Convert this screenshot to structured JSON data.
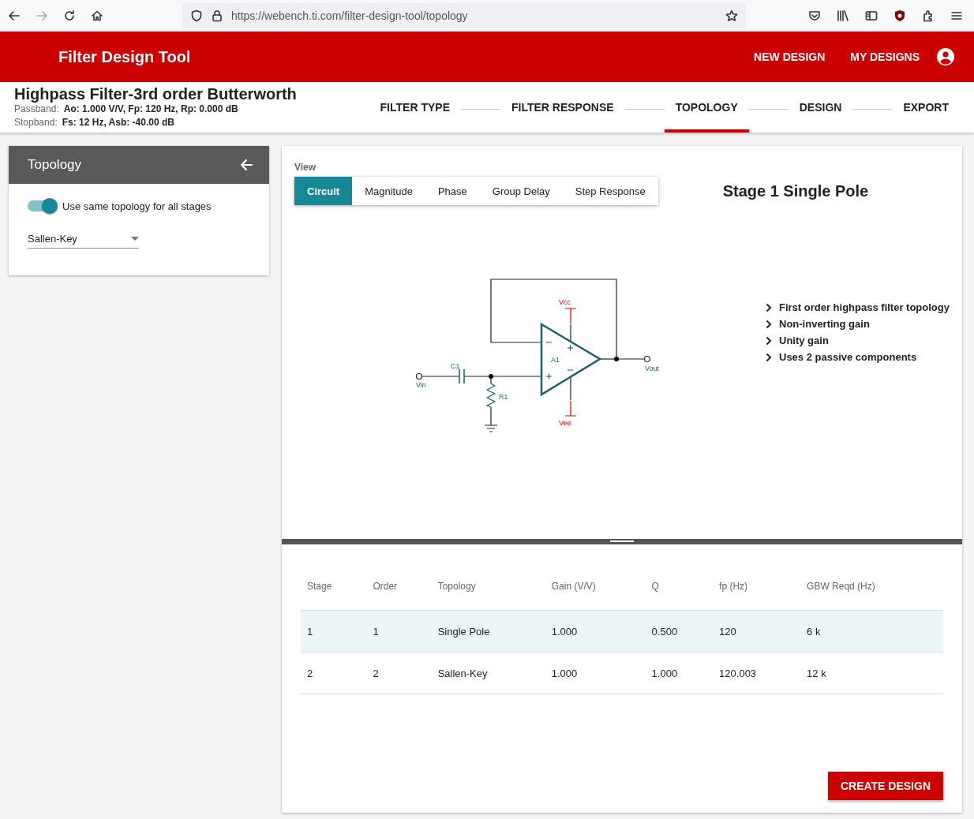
{
  "browser": {
    "url": "https://webench.ti.com/filter-design-tool/topology"
  },
  "app_bar": {
    "title": "Filter Design Tool",
    "actions": [
      "NEW DESIGN",
      "MY DESIGNS"
    ]
  },
  "design": {
    "title": "Highpass Filter-3rd order Butterworth",
    "specs": [
      {
        "label": "Passband:",
        "value": "Ao: 1.000 V/V, Fp: 120 Hz, Rp: 0.000 dB"
      },
      {
        "label": "Stopband:",
        "value": "Fs: 12 Hz, Asb: -40.00 dB"
      }
    ]
  },
  "stepper": [
    {
      "label": "FILTER TYPE",
      "selected": false
    },
    {
      "label": "FILTER RESPONSE",
      "selected": false
    },
    {
      "label": "TOPOLOGY",
      "selected": true
    },
    {
      "label": "DESIGN",
      "selected": false
    },
    {
      "label": "EXPORT",
      "selected": false
    }
  ],
  "sidebar": {
    "title": "Topology",
    "toggle": {
      "label": "Use same topology for all stages",
      "on": true
    },
    "select": {
      "value": "Sallen-Key"
    }
  },
  "view": {
    "label": "View",
    "tabs": [
      {
        "label": "Circuit",
        "selected": true
      },
      {
        "label": "Magnitude",
        "selected": false
      },
      {
        "label": "Phase",
        "selected": false
      },
      {
        "label": "Group Delay",
        "selected": false
      },
      {
        "label": "Step Response",
        "selected": false
      }
    ],
    "stage_title": "Stage 1 Single Pole",
    "circuit": {
      "input": "Vin",
      "output": "Vout",
      "capacitor": "C1",
      "resistor": "R1",
      "opamp": "A1",
      "supply_positive": "Vcc",
      "supply_negative": "Vee"
    },
    "features": [
      "First order highpass filter topology",
      "Non-inverting gain",
      "Unity gain",
      "Uses 2 passive components"
    ]
  },
  "table": {
    "columns": [
      "Stage",
      "Order",
      "Topology",
      "Gain (V/V)",
      "Q",
      "fp (Hz)",
      "GBW Reqd (Hz)"
    ],
    "rows": [
      {
        "selected": true,
        "cells": [
          "1",
          "1",
          "Single Pole",
          "1.000",
          "0.500",
          "120",
          "6 k"
        ]
      },
      {
        "selected": false,
        "cells": [
          "2",
          "2",
          "Sallen-Key",
          "1.000",
          "1.000",
          "120.003",
          "12 k"
        ]
      }
    ]
  },
  "create_button": "CREATE DESIGN"
}
